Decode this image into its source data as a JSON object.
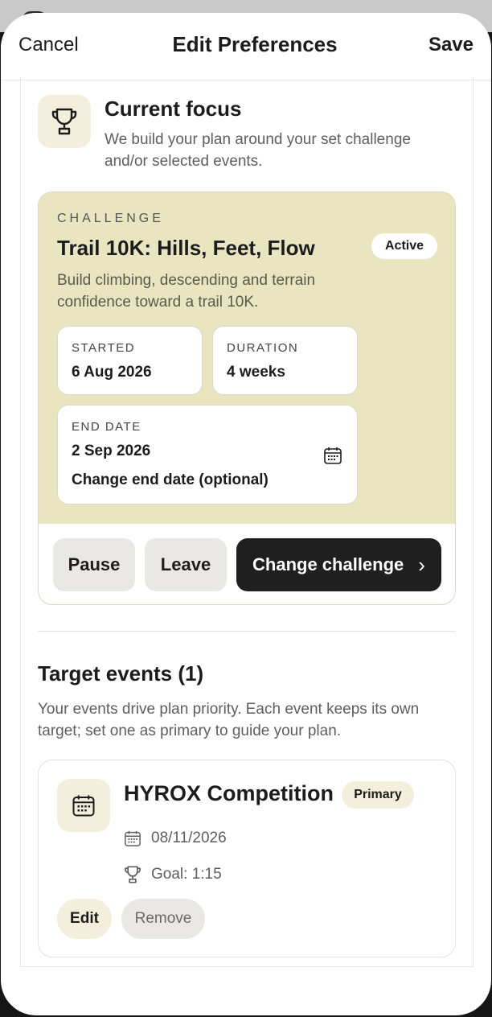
{
  "nav": {
    "cancel": "Cancel",
    "title": "Edit Preferences",
    "save": "Save"
  },
  "focus": {
    "title": "Current focus",
    "description": "We build your plan around your set challenge and/or selected events."
  },
  "challenge": {
    "label": "CHALLENGE",
    "name": "Trail 10K: Hills, Feet, Flow",
    "badge": "Active",
    "description": "Build climbing, descending and terrain confidence toward a trail 10K.",
    "started_label": "STARTED",
    "started_value": "6 Aug 2026",
    "duration_label": "DURATION",
    "duration_value": "4 weeks",
    "end_label": "END DATE",
    "end_value": "2 Sep 2026",
    "end_change": "Change end date (optional)",
    "pause_label": "Pause",
    "leave_label": "Leave",
    "change_label": "Change challenge",
    "change_chevron": "›"
  },
  "events": {
    "title": "Target events (1)",
    "description": "Your events drive plan priority. Each event keeps its own target; set one as primary to guide your plan.",
    "items": [
      {
        "name": "HYROX Competition",
        "badge": "Primary",
        "date": "08/11/2026",
        "goal": "Goal: 1:15",
        "edit_label": "Edit",
        "remove_label": "Remove"
      }
    ]
  },
  "icons": {
    "focus": "trophy-icon",
    "end_date": "calendar-icon",
    "event": "calendar-icon",
    "event_date": "calendar-icon",
    "event_goal": "trophy-icon",
    "chevron": "chevron-right-icon"
  },
  "colors": {
    "challenge_bg": "#e8e5c0",
    "accent_bg": "#f4efdc",
    "dark_button": "#1f1f1f",
    "grey_button": "#e9e8e4"
  }
}
